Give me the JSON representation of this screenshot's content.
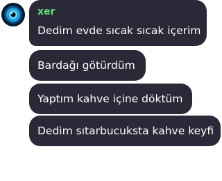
{
  "sender": {
    "name": "xer",
    "name_color": "#5ee17a",
    "avatar_icon": "eye-icon"
  },
  "bubble_color": "#2b2838",
  "messages": [
    {
      "text": "Dedim evde sıcak sıcak içerim"
    },
    {
      "text": "Bardağı götürdüm"
    },
    {
      "text": "Yaptım kahve içine döktüm"
    },
    {
      "text": "Dedim sıtarbucuksta kahve keyfi"
    }
  ]
}
